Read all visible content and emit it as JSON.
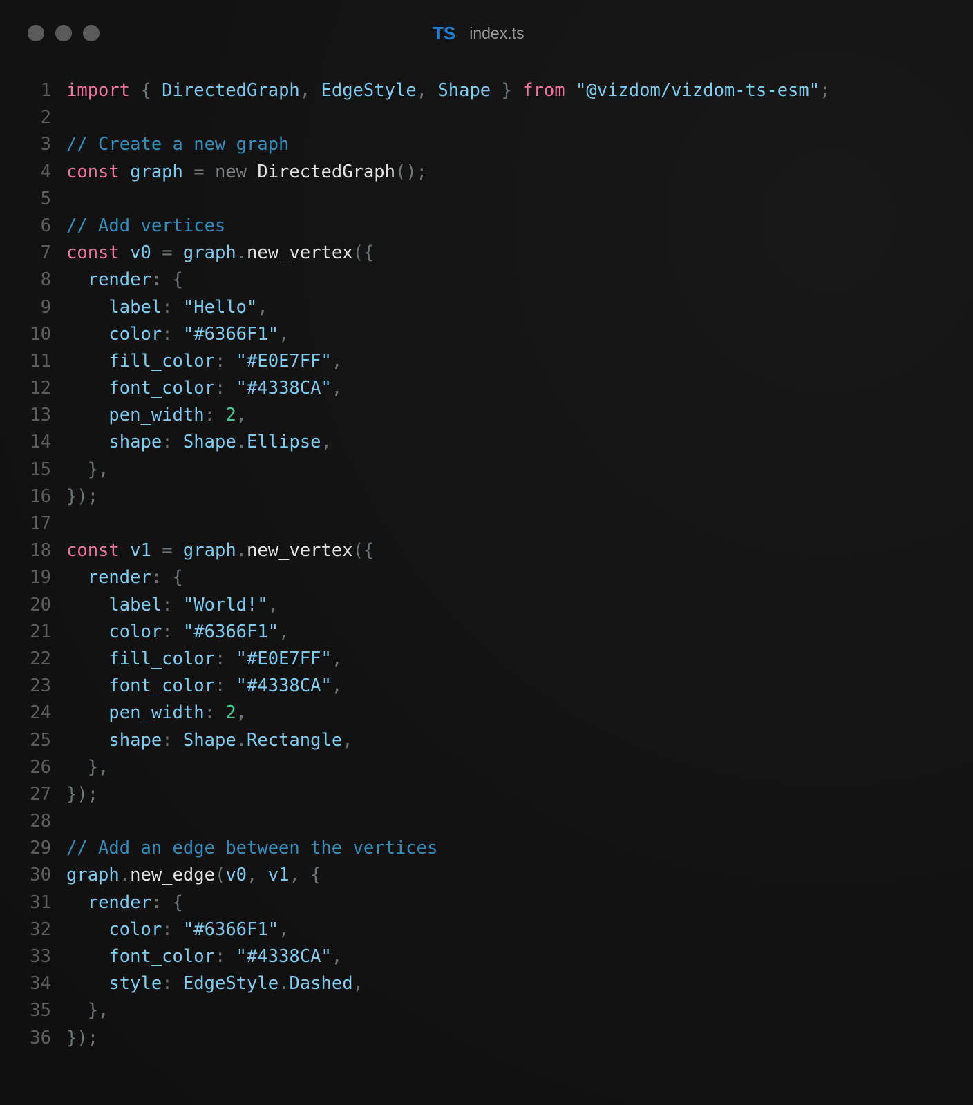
{
  "window": {
    "title_icon": "TS",
    "filename": "index.ts",
    "traffic_lights": [
      "close",
      "minimize",
      "maximize"
    ]
  },
  "code": {
    "language": "typescript",
    "lines": [
      {
        "n": "1",
        "tokens": [
          [
            "kw",
            "import"
          ],
          [
            "pn",
            " { "
          ],
          [
            "id",
            "DirectedGraph"
          ],
          [
            "pn",
            ", "
          ],
          [
            "id",
            "EdgeStyle"
          ],
          [
            "pn",
            ", "
          ],
          [
            "id",
            "Shape"
          ],
          [
            "pn",
            " } "
          ],
          [
            "kw",
            "from"
          ],
          [
            "pn",
            " "
          ],
          [
            "st",
            "\"@vizdom/vizdom-ts-esm\""
          ],
          [
            "pn",
            ";"
          ]
        ]
      },
      {
        "n": "2",
        "tokens": []
      },
      {
        "n": "3",
        "tokens": [
          [
            "cm",
            "// Create a new graph"
          ]
        ]
      },
      {
        "n": "4",
        "tokens": [
          [
            "kw",
            "const"
          ],
          [
            "pn",
            " "
          ],
          [
            "id",
            "graph"
          ],
          [
            "pn",
            " = "
          ],
          [
            "nw",
            "new"
          ],
          [
            "pn",
            " "
          ],
          [
            "fn",
            "DirectedGraph"
          ],
          [
            "pn",
            "();"
          ]
        ]
      },
      {
        "n": "5",
        "tokens": []
      },
      {
        "n": "6",
        "tokens": [
          [
            "cm",
            "// Add vertices"
          ]
        ]
      },
      {
        "n": "7",
        "tokens": [
          [
            "kw",
            "const"
          ],
          [
            "pn",
            " "
          ],
          [
            "id",
            "v0"
          ],
          [
            "pn",
            " = "
          ],
          [
            "id",
            "graph"
          ],
          [
            "pn",
            "."
          ],
          [
            "fn",
            "new_vertex"
          ],
          [
            "pn",
            "({"
          ]
        ]
      },
      {
        "n": "8",
        "tokens": [
          [
            "pn",
            "  "
          ],
          [
            "id",
            "render"
          ],
          [
            "pn",
            ": {"
          ]
        ]
      },
      {
        "n": "9",
        "tokens": [
          [
            "pn",
            "    "
          ],
          [
            "id",
            "label"
          ],
          [
            "pn",
            ": "
          ],
          [
            "st",
            "\"Hello\""
          ],
          [
            "pn",
            ","
          ]
        ]
      },
      {
        "n": "10",
        "tokens": [
          [
            "pn",
            "    "
          ],
          [
            "id",
            "color"
          ],
          [
            "pn",
            ": "
          ],
          [
            "st",
            "\"#6366F1\""
          ],
          [
            "pn",
            ","
          ]
        ]
      },
      {
        "n": "11",
        "tokens": [
          [
            "pn",
            "    "
          ],
          [
            "id",
            "fill_color"
          ],
          [
            "pn",
            ": "
          ],
          [
            "st",
            "\"#E0E7FF\""
          ],
          [
            "pn",
            ","
          ]
        ]
      },
      {
        "n": "12",
        "tokens": [
          [
            "pn",
            "    "
          ],
          [
            "id",
            "font_color"
          ],
          [
            "pn",
            ": "
          ],
          [
            "st",
            "\"#4338CA\""
          ],
          [
            "pn",
            ","
          ]
        ]
      },
      {
        "n": "13",
        "tokens": [
          [
            "pn",
            "    "
          ],
          [
            "id",
            "pen_width"
          ],
          [
            "pn",
            ": "
          ],
          [
            "nm",
            "2"
          ],
          [
            "pn",
            ","
          ]
        ]
      },
      {
        "n": "14",
        "tokens": [
          [
            "pn",
            "    "
          ],
          [
            "id",
            "shape"
          ],
          [
            "pn",
            ": "
          ],
          [
            "id",
            "Shape"
          ],
          [
            "pn",
            "."
          ],
          [
            "id",
            "Ellipse"
          ],
          [
            "pn",
            ","
          ]
        ]
      },
      {
        "n": "15",
        "tokens": [
          [
            "pn",
            "  },"
          ]
        ]
      },
      {
        "n": "16",
        "tokens": [
          [
            "pn",
            "});"
          ]
        ]
      },
      {
        "n": "17",
        "tokens": []
      },
      {
        "n": "18",
        "tokens": [
          [
            "kw",
            "const"
          ],
          [
            "pn",
            " "
          ],
          [
            "id",
            "v1"
          ],
          [
            "pn",
            " = "
          ],
          [
            "id",
            "graph"
          ],
          [
            "pn",
            "."
          ],
          [
            "fn",
            "new_vertex"
          ],
          [
            "pn",
            "({"
          ]
        ]
      },
      {
        "n": "19",
        "tokens": [
          [
            "pn",
            "  "
          ],
          [
            "id",
            "render"
          ],
          [
            "pn",
            ": {"
          ]
        ]
      },
      {
        "n": "20",
        "tokens": [
          [
            "pn",
            "    "
          ],
          [
            "id",
            "label"
          ],
          [
            "pn",
            ": "
          ],
          [
            "st",
            "\"World!\""
          ],
          [
            "pn",
            ","
          ]
        ]
      },
      {
        "n": "21",
        "tokens": [
          [
            "pn",
            "    "
          ],
          [
            "id",
            "color"
          ],
          [
            "pn",
            ": "
          ],
          [
            "st",
            "\"#6366F1\""
          ],
          [
            "pn",
            ","
          ]
        ]
      },
      {
        "n": "22",
        "tokens": [
          [
            "pn",
            "    "
          ],
          [
            "id",
            "fill_color"
          ],
          [
            "pn",
            ": "
          ],
          [
            "st",
            "\"#E0E7FF\""
          ],
          [
            "pn",
            ","
          ]
        ]
      },
      {
        "n": "23",
        "tokens": [
          [
            "pn",
            "    "
          ],
          [
            "id",
            "font_color"
          ],
          [
            "pn",
            ": "
          ],
          [
            "st",
            "\"#4338CA\""
          ],
          [
            "pn",
            ","
          ]
        ]
      },
      {
        "n": "24",
        "tokens": [
          [
            "pn",
            "    "
          ],
          [
            "id",
            "pen_width"
          ],
          [
            "pn",
            ": "
          ],
          [
            "nm",
            "2"
          ],
          [
            "pn",
            ","
          ]
        ]
      },
      {
        "n": "25",
        "tokens": [
          [
            "pn",
            "    "
          ],
          [
            "id",
            "shape"
          ],
          [
            "pn",
            ": "
          ],
          [
            "id",
            "Shape"
          ],
          [
            "pn",
            "."
          ],
          [
            "id",
            "Rectangle"
          ],
          [
            "pn",
            ","
          ]
        ]
      },
      {
        "n": "26",
        "tokens": [
          [
            "pn",
            "  },"
          ]
        ]
      },
      {
        "n": "27",
        "tokens": [
          [
            "pn",
            "});"
          ]
        ]
      },
      {
        "n": "28",
        "tokens": []
      },
      {
        "n": "29",
        "tokens": [
          [
            "cm",
            "// Add an edge between the vertices"
          ]
        ]
      },
      {
        "n": "30",
        "tokens": [
          [
            "id",
            "graph"
          ],
          [
            "pn",
            "."
          ],
          [
            "fn",
            "new_edge"
          ],
          [
            "pn",
            "("
          ],
          [
            "id",
            "v0"
          ],
          [
            "pn",
            ", "
          ],
          [
            "id",
            "v1"
          ],
          [
            "pn",
            ", {"
          ]
        ]
      },
      {
        "n": "31",
        "tokens": [
          [
            "pn",
            "  "
          ],
          [
            "id",
            "render"
          ],
          [
            "pn",
            ": {"
          ]
        ]
      },
      {
        "n": "32",
        "tokens": [
          [
            "pn",
            "    "
          ],
          [
            "id",
            "color"
          ],
          [
            "pn",
            ": "
          ],
          [
            "st",
            "\"#6366F1\""
          ],
          [
            "pn",
            ","
          ]
        ]
      },
      {
        "n": "33",
        "tokens": [
          [
            "pn",
            "    "
          ],
          [
            "id",
            "font_color"
          ],
          [
            "pn",
            ": "
          ],
          [
            "st",
            "\"#4338CA\""
          ],
          [
            "pn",
            ","
          ]
        ]
      },
      {
        "n": "34",
        "tokens": [
          [
            "pn",
            "    "
          ],
          [
            "id",
            "style"
          ],
          [
            "pn",
            ": "
          ],
          [
            "id",
            "EdgeStyle"
          ],
          [
            "pn",
            "."
          ],
          [
            "id",
            "Dashed"
          ],
          [
            "pn",
            ","
          ]
        ]
      },
      {
        "n": "35",
        "tokens": [
          [
            "pn",
            "  },"
          ]
        ]
      },
      {
        "n": "36",
        "tokens": [
          [
            "pn",
            "});"
          ]
        ]
      }
    ]
  },
  "colors": {
    "background": "#121212",
    "keyword": "#f0749c",
    "identifier": "#7ccdf2",
    "comment": "#2e8fbf",
    "number": "#3ecf8e",
    "punctuation": "#6b7479",
    "line_number": "#5d5d5d",
    "ts_badge": "#1f7fd6"
  }
}
